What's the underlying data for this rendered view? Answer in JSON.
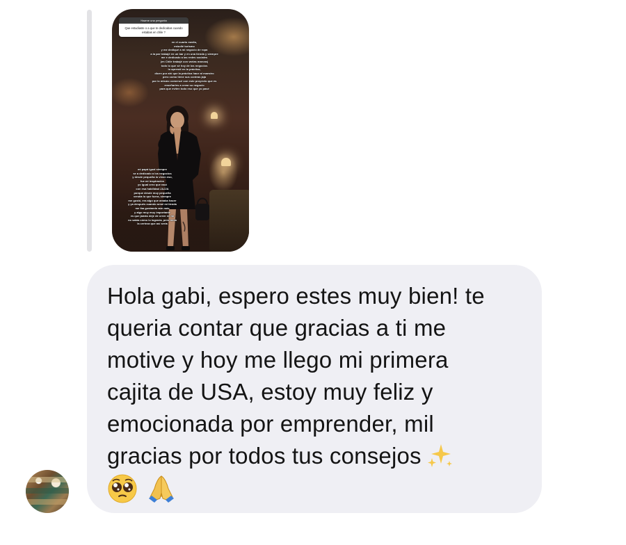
{
  "story_reply": {
    "question_header": "Hazme una pregunta",
    "question_text": "Que estudiaste o a que te dedicabas cuando estabas en chile ?",
    "story_text_top": "en el cuarto medio,\nestudié turismo\ny me dediqué a mi negocio de ropa\na la par trabajé en un bar y en una tienda y siempre\nme e dedicado a las redes sociales\n(en Chile trabajé con varias marcas)\ntodo lo que sé hoy de los negocios\nlo aprendí en la práctica,\ndicen por ahí que la práctica hace al maestro\npero como tiene sus contras jaja\npor lo mismo comencé con este proyecto que es\nenseñarles a crear su negocio\npara que eviten todo eso que yo pasé",
    "story_text_bottom": "mi papá igual siempre\nse a dedicado a los negocios\ny desde pequeña lo viven eso,\nfue mi inspiración\nyo igual creo que nací\ncon esa habilidad JAJJA\nporque desde muy pequeña\nvendía lo que fuera, siempre\nme gustó, era algo que amaba hacer\ny ya después cuando armé mi tienda\nme iba gustando aún más\ny algo muy muy importante\nes que jamás deje de creer en mí\nno sabía cómo lo lograría, pero tenía\nla certeza que así sería"
  },
  "message": {
    "text": "Hola gabi, espero estes muy bien! te\nqueria contar que gracias a ti me\nmotive y hoy me llego mi primera\ncajita de USA, estoy muy feliz y\nemocionada por emprender, mil\ngracias por todos tus consejos",
    "trailing_emoji": "sparkles-emoji",
    "emoji_line": [
      "pleading-face-emoji",
      "folded-hands-emoji"
    ]
  },
  "colors": {
    "bubble_bg": "#efeff4",
    "text": "#141414",
    "quote_line": "#e3e3e6"
  }
}
